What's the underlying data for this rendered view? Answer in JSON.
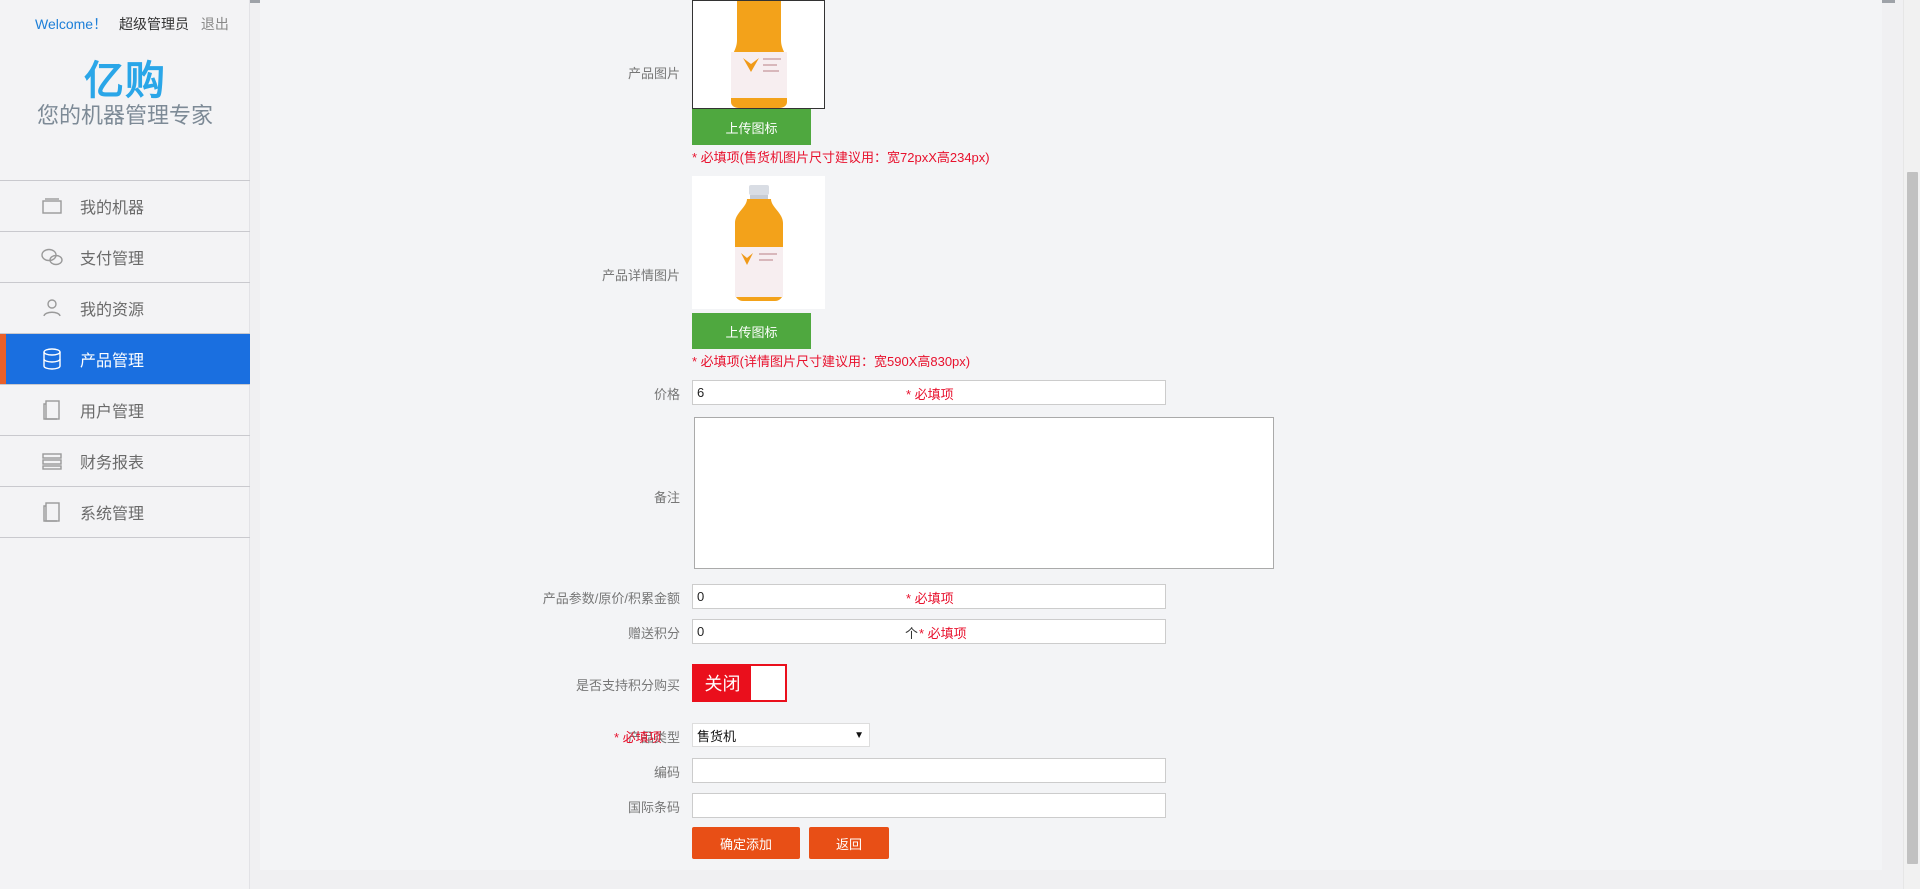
{
  "header": {
    "welcome": "Welcome！",
    "user": "超级管理员",
    "logout": "退出",
    "logo": "亿购",
    "slogan": "您的机器管理专家"
  },
  "nav": [
    {
      "label": "我的机器",
      "icon": "machine-icon",
      "active": false
    },
    {
      "label": "支付管理",
      "icon": "wechat-icon",
      "active": false
    },
    {
      "label": "我的资源",
      "icon": "user-icon",
      "active": false
    },
    {
      "label": "产品管理",
      "icon": "database-icon",
      "active": true
    },
    {
      "label": "用户管理",
      "icon": "document-icon",
      "active": false
    },
    {
      "label": "财务报表",
      "icon": "list-icon",
      "active": false
    },
    {
      "label": "系统管理",
      "icon": "document-icon",
      "active": false
    }
  ],
  "form": {
    "product_image_label": "产品图片",
    "upload_label": "上传图标",
    "product_image_tip": "* 必填项(售货机图片尺寸建议用：宽72pxX高234px)",
    "detail_image_label": "产品详情图片",
    "detail_image_tip": "* 必填项(详情图片尺寸建议用：宽590X高830px)",
    "price_label": "价格",
    "price_value": "6",
    "required": "* 必填项",
    "remark_label": "备注",
    "remark_value": "",
    "params_label": "产品参数/原价/积累金额",
    "params_value": "0",
    "points_label": "赠送积分",
    "points_value": "0",
    "points_unit": "个",
    "points_purchase_label": "是否支持积分购买",
    "toggle_text": "关闭",
    "type_label": "产品类型",
    "type_value": "售货机",
    "code_label": "编码",
    "code_value": "",
    "barcode_label": "国际条码",
    "barcode_value": "",
    "submit_label": "确定添加",
    "back_label": "返回"
  },
  "colors": {
    "accent": "#1a6fe0",
    "active_marker": "#e8602a",
    "upload": "#4fa83f",
    "required": "#e8112d",
    "toggle": "#ea0f1c",
    "primary_button": "#e84f16"
  }
}
